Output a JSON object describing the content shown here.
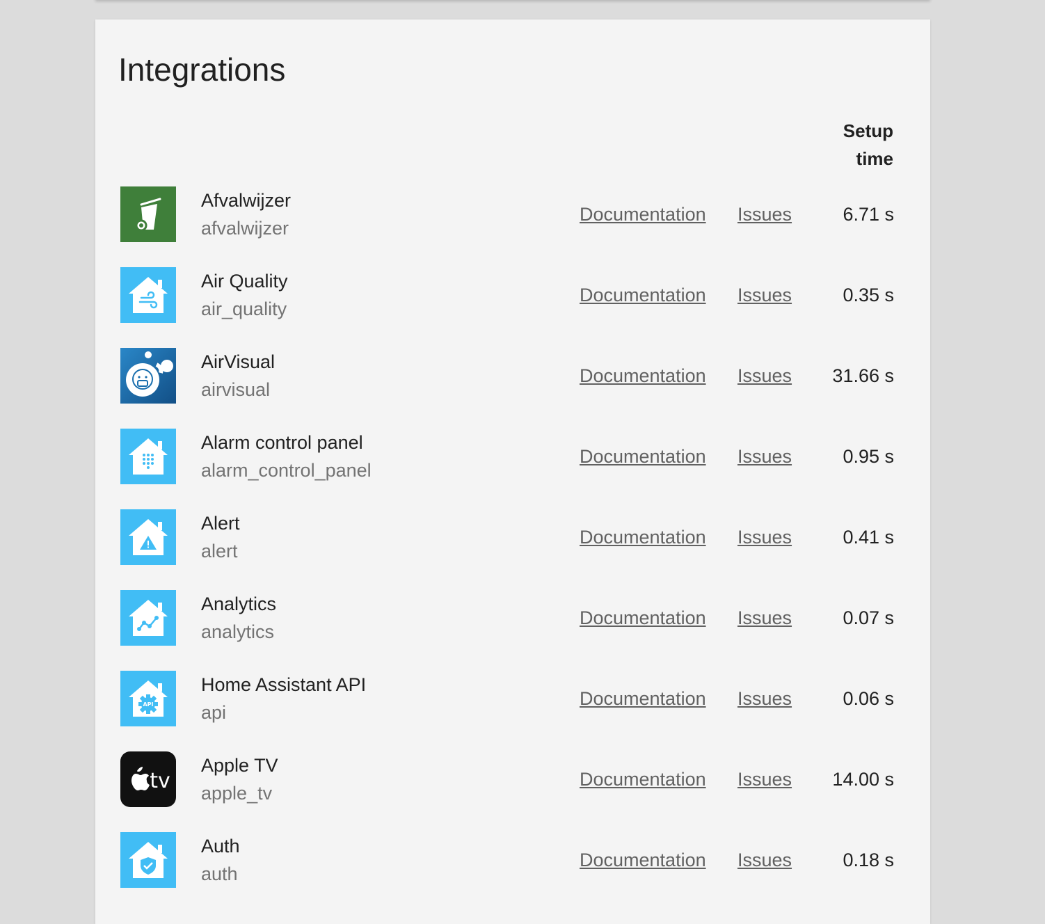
{
  "card": {
    "title": "Integrations",
    "column_header": "Setup time",
    "column_header_line1": "Setup",
    "column_header_line2": "time"
  },
  "colors": {
    "page_background": "#dcdcdc",
    "card_background": "#f4f4f4",
    "ha_blue": "#41bdf5",
    "afvalwijzer_green": "#3f7f3a",
    "airvisual_blue": "#1a6fae",
    "appletv_black": "#111111",
    "link": "#616161",
    "secondary_text": "#737373"
  },
  "integrations": [
    {
      "name": "Afvalwijzer",
      "domain": "afvalwijzer",
      "documentation": "Documentation",
      "issues": "Issues",
      "setup_time": "6.71 s",
      "icon": "trash-bin-icon"
    },
    {
      "name": "Air Quality",
      "domain": "air_quality",
      "documentation": "Documentation",
      "issues": "Issues",
      "setup_time": "0.35 s",
      "icon": "home-air-quality-icon"
    },
    {
      "name": "AirVisual",
      "domain": "airvisual",
      "documentation": "Documentation",
      "issues": "Issues",
      "setup_time": "31.66 s",
      "icon": "airvisual-mask-icon"
    },
    {
      "name": "Alarm control panel",
      "domain": "alarm_control_panel",
      "documentation": "Documentation",
      "issues": "Issues",
      "setup_time": "0.95 s",
      "icon": "home-keypad-icon"
    },
    {
      "name": "Alert",
      "domain": "alert",
      "documentation": "Documentation",
      "issues": "Issues",
      "setup_time": "0.41 s",
      "icon": "home-alert-icon"
    },
    {
      "name": "Analytics",
      "domain": "analytics",
      "documentation": "Documentation",
      "issues": "Issues",
      "setup_time": "0.07 s",
      "icon": "home-analytics-icon"
    },
    {
      "name": "Home Assistant API",
      "domain": "api",
      "documentation": "Documentation",
      "issues": "Issues",
      "setup_time": "0.06 s",
      "icon": "home-api-icon",
      "icon_label": "API"
    },
    {
      "name": "Apple TV",
      "domain": "apple_tv",
      "documentation": "Documentation",
      "issues": "Issues",
      "setup_time": "14.00 s",
      "icon": "apple-tv-icon",
      "icon_label": "tv"
    },
    {
      "name": "Auth",
      "domain": "auth",
      "documentation": "Documentation",
      "issues": "Issues",
      "setup_time": "0.18 s",
      "icon": "home-shield-icon"
    }
  ]
}
